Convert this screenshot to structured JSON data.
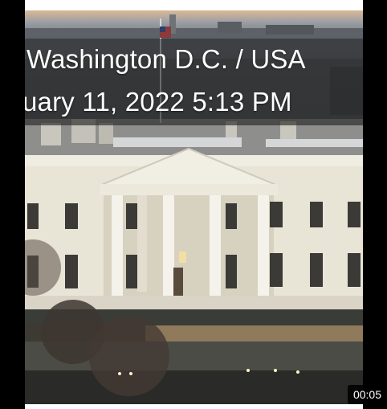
{
  "video": {
    "overlay_line_1": "Washington D.C. / USA",
    "overlay_line_2": "uary 11, 2022 5:13 PM",
    "duration": "00:05"
  }
}
